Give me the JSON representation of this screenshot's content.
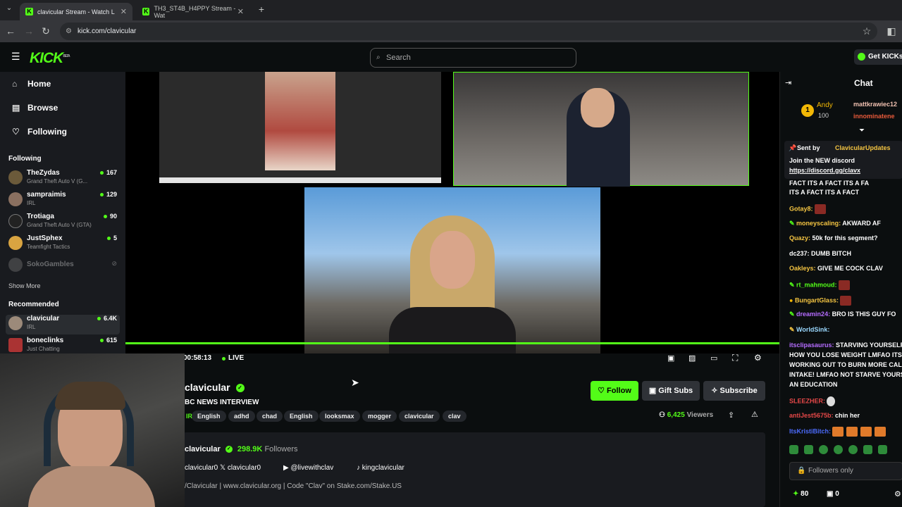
{
  "browser": {
    "tabs": [
      {
        "label": "clavicular Stream - Watch L",
        "active": true
      },
      {
        "label": "TH3_ST4B_H4PPY Stream - Wat",
        "active": false
      }
    ],
    "url": "kick.com/clavicular"
  },
  "header": {
    "logo": "KICK",
    "logo_sup": "BETA",
    "search_placeholder": "Search",
    "get_kicks": "Get KICKs"
  },
  "sidebar": {
    "nav": [
      {
        "label": "Home",
        "icon": "home-icon"
      },
      {
        "label": "Browse",
        "icon": "browse-icon"
      },
      {
        "label": "Following",
        "icon": "heart-icon"
      }
    ],
    "following_title": "Following",
    "following": [
      {
        "name": "TheZydas",
        "category": "Grand Theft Auto V (G...",
        "viewers": "167"
      },
      {
        "name": "sampraimis",
        "category": "IRL",
        "viewers": "129"
      },
      {
        "name": "Trotiaga",
        "category": "Grand Theft Auto V (GTA)",
        "viewers": "90"
      },
      {
        "name": "JustSphex",
        "category": "Teamfight Tactics",
        "viewers": "5"
      },
      {
        "name": "SokoGambles",
        "category": "",
        "viewers": ""
      }
    ],
    "show_more": "Show More",
    "recommended_title": "Recommended",
    "recommended": [
      {
        "name": "clavicular",
        "category": "IRL",
        "viewers": "6.4K"
      },
      {
        "name": "boneclinks",
        "category": "Just Chatting",
        "viewers": "615"
      }
    ]
  },
  "player": {
    "time": "00:58:13",
    "live": "LIVE"
  },
  "stream": {
    "channel": "clavicular",
    "title": "BC NEWS INTERVIEW",
    "tags": [
      "IRL",
      "English",
      "adhd",
      "chad",
      "English",
      "looksmax",
      "mogger",
      "clavicular",
      "clav"
    ],
    "follow": "Follow",
    "gift_subs": "Gift Subs",
    "subscribe": "Subscribe",
    "viewers": "6,425",
    "viewers_label": "Viewers"
  },
  "about": {
    "name": "clavicular",
    "followers": "298.9K",
    "followers_label": "Followers",
    "socials": [
      {
        "label": "clavicular0",
        "icon": "instagram-icon"
      },
      {
        "label": "clavicular0",
        "icon": "x-icon"
      },
      {
        "label": "@livewithclav",
        "icon": "youtube-icon"
      },
      {
        "label": "kingclavicular",
        "icon": "tiktok-icon"
      }
    ],
    "bio": "/Clavicular | www.clavicular.org | Code \"Clav\" on Stake.com/Stake.US"
  },
  "chat": {
    "title": "Chat",
    "top_user": "Andy",
    "top_amount": "100",
    "top_names": [
      "mattkrawiec12",
      "innominatene"
    ],
    "pinned_by_label": "Sent by",
    "pinned_by": "ClavicularUpdates",
    "pinned_text": "Join the NEW discord",
    "pinned_link": "https://discord.gg/clavx",
    "messages": [
      {
        "user": "",
        "text": "FACT ITS A FACT ITS A FA",
        "color": "#ffffff"
      },
      {
        "user": "",
        "text": "ITS A FACT ITS A FACT",
        "color": "#ffffff"
      },
      {
        "user": "Gotay8:",
        "text": "",
        "color": "#f5c542"
      },
      {
        "user": "moneyscaling:",
        "text": "AKWARD AF",
        "color": "#f5c542"
      },
      {
        "user": "Quazy:",
        "text": "50k for this segment?",
        "color": "#f5c542"
      },
      {
        "user": "dc237:",
        "text": "DUMB BITCH",
        "color": "#ffffff"
      },
      {
        "user": "Oakleys:",
        "text": "GIVE ME COCK CLAV",
        "color": "#f5c542"
      },
      {
        "user": "rt_mahmoud:",
        "text": "",
        "color": "#53fc18"
      },
      {
        "user": "BungartGlass:",
        "text": "",
        "color": "#f5c542"
      },
      {
        "user": "dreamin24:",
        "text": "BRO IS THIS GUY FO",
        "color": "#b56cff"
      },
      {
        "user": "WorldSink:",
        "text": "",
        "color": "#9ad8ff"
      },
      {
        "user": "itsclipasaurus:",
        "text": "STARVING YOURSELF",
        "color": "#b56cff"
      },
      {
        "user": "",
        "text": "HOW YOU LOSE WEIGHT LMFAO ITS",
        "color": "#ffffff"
      },
      {
        "user": "",
        "text": "WORKING OUT TO BURN MORE CAL",
        "color": "#ffffff"
      },
      {
        "user": "",
        "text": "INTAKE! LMFAO NOT STARVE YOURS",
        "color": "#ffffff"
      },
      {
        "user": "",
        "text": "AN EDUCATION",
        "color": "#ffffff"
      },
      {
        "user": "SLEEZHER:",
        "text": "",
        "color": "#e64848"
      },
      {
        "user": "antiJest5675b:",
        "text": "chin her",
        "color": "#e64848"
      },
      {
        "user": "ItsKristiBitch:",
        "text": "",
        "color": "#4c6cff"
      }
    ],
    "followers_only": "Followers only",
    "points": "80",
    "gifts": "0"
  },
  "colors": {
    "accent": "#53fc18",
    "bg": "#0b0e0f",
    "sidebar": "#191b1f"
  }
}
